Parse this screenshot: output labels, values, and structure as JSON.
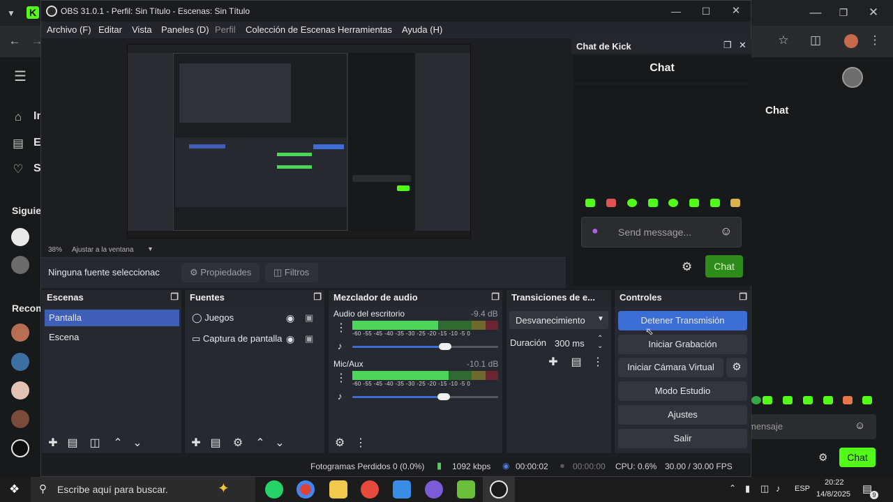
{
  "obs": {
    "title": "OBS 31.0.1 - Perfil: Sin Título - Escenas: Sin Título",
    "menu": [
      "Archivo (F)",
      "Editar",
      "Vista",
      "Paneles (D)",
      "Perfil",
      "Colección de Escenas",
      "Herramientas",
      "Ayuda (H)"
    ],
    "zoom": "38%",
    "fit_label": "Ajustar a la ventana",
    "no_source": "Ninguna fuente seleccionac",
    "properties_btn": "Propiedades",
    "filters_btn": "Filtros",
    "docks": {
      "scenes": {
        "title": "Escenas",
        "items": [
          "Pantalla",
          "Escena"
        ],
        "selected": "Pantalla"
      },
      "sources": {
        "title": "Fuentes",
        "items": [
          "Juegos",
          "Captura de pantalla"
        ]
      },
      "mixer": {
        "title": "Mezclador de audio",
        "channels": [
          {
            "name": "Audio del escritorio",
            "db": "-9.4 dB",
            "level": 0.56
          },
          {
            "name": "Mic/Aux",
            "db": "-10.1 dB",
            "level": 0.55
          }
        ],
        "ticks": "-60 -55 -45 -40 -35 -30 -25 -20 -15 -10 -5 0"
      },
      "transitions": {
        "title": "Transiciones de e...",
        "transition": "Desvanecimiento",
        "duration_label": "Duración",
        "duration": "300 ms"
      },
      "controls": {
        "title": "Controles",
        "stop_stream": "Detener Transmisión",
        "start_rec": "Iniciar Grabación",
        "virtual_cam": "Iniciar Cámara Virtual",
        "studio": "Modo Estudio",
        "settings": "Ajustes",
        "exit": "Salir"
      }
    },
    "status": {
      "dropped": "Fotogramas Perdidos 0 (0.0%)",
      "kbps": "1092 kbps",
      "stream_time": "00:00:02",
      "rec_time": "00:00:00",
      "cpu": "CPU: 0.6%",
      "fps": "30.00 / 30.00 FPS"
    }
  },
  "chat_dock": {
    "title": "Chat de Kick",
    "header": "Chat",
    "placeholder": "Send message...",
    "send": "Chat"
  },
  "browser": {
    "right_header": "Chat",
    "right_placeholder": "mensaje",
    "right_send": "Chat",
    "side_labels": [
      "In",
      "E",
      "S"
    ],
    "following": "Siguien",
    "recommended": "Recom"
  },
  "taskbar": {
    "search_placeholder": "Escribe aquí para buscar.",
    "lang": "ESP",
    "time": "20:22",
    "date": "14/8/2025",
    "notif_count": "9"
  },
  "colors": {
    "accent": "#3d6ed6",
    "kick_green": "#53fc18",
    "selected_scene": "#3e5eb8"
  }
}
